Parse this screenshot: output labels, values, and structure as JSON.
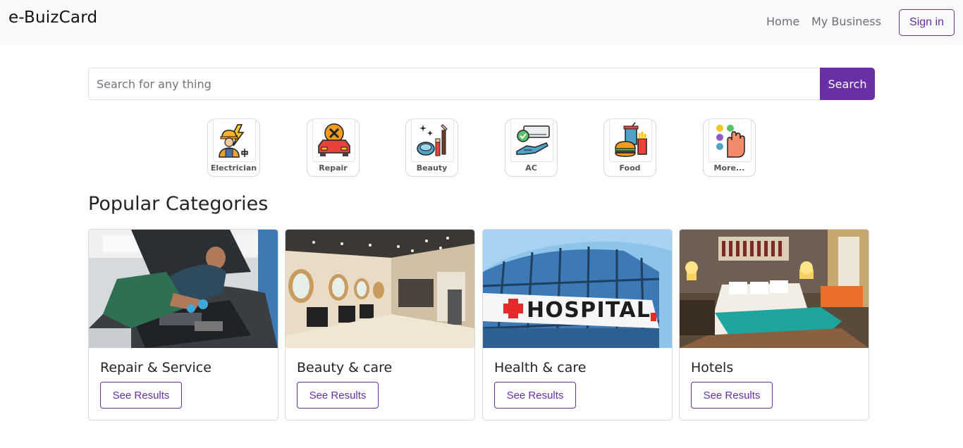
{
  "navbar": {
    "brand": "e-BuizCard",
    "links": [
      {
        "label": "Home"
      },
      {
        "label": "My Business"
      }
    ],
    "signin_label": "Sign in"
  },
  "search": {
    "placeholder": "Search for any thing",
    "value": "",
    "button_label": "Search"
  },
  "quick_categories": [
    {
      "label": "Electrician",
      "icon": "electrician-icon"
    },
    {
      "label": "Repair",
      "icon": "car-repair-icon"
    },
    {
      "label": "Beauty",
      "icon": "beauty-icon"
    },
    {
      "label": "AC",
      "icon": "ac-icon"
    },
    {
      "label": "Food",
      "icon": "food-icon"
    },
    {
      "label": "More...",
      "icon": "more-icon"
    }
  ],
  "popular": {
    "title": "Popular Categories",
    "cards": [
      {
        "title": "Repair & Service",
        "button": "See Results",
        "image": "mechanic-photo"
      },
      {
        "title": "Beauty & care",
        "button": "See Results",
        "image": "salon-photo"
      },
      {
        "title": "Health & care",
        "button": "See Results",
        "image": "hospital-photo",
        "sign_text": "HOSPITAL"
      },
      {
        "title": "Hotels",
        "button": "See Results",
        "image": "hotel-room-photo"
      }
    ]
  },
  "colors": {
    "accent": "#6a2fa5",
    "navbar_bg": "#f8f9fa"
  }
}
